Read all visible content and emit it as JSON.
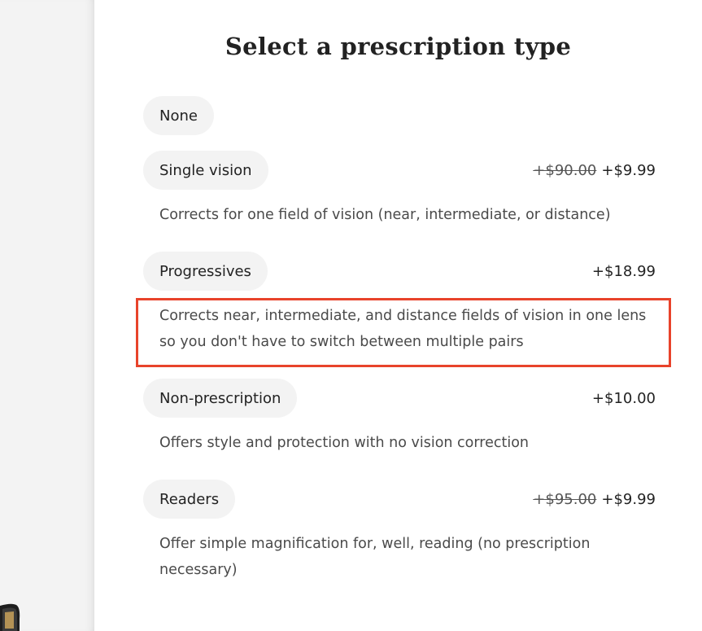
{
  "page_title": "Select a prescription type",
  "options": [
    {
      "label": "None",
      "old_price": "",
      "price": "",
      "description": ""
    },
    {
      "label": "Single vision",
      "old_price": "+$90.00",
      "price": "+$9.99",
      "description": "Corrects for one field of vision (near, intermediate, or distance)"
    },
    {
      "label": "Progressives",
      "old_price": "",
      "price": "+$18.99",
      "description": "Corrects near, intermediate, and distance fields of vision in one lens so you don't have to switch between multiple pairs"
    },
    {
      "label": "Non-prescription",
      "old_price": "",
      "price": "+$10.00",
      "description": "Offers style and protection with no vision correction"
    },
    {
      "label": "Readers",
      "old_price": "+$95.00",
      "price": "+$9.99",
      "description": "Offer simple magnification for, well, reading (no prescription necessary)"
    }
  ],
  "colors": {
    "highlight": "#e8432b",
    "pill_background": "#f3f3f3",
    "left_pane": "#f3f3f3"
  }
}
